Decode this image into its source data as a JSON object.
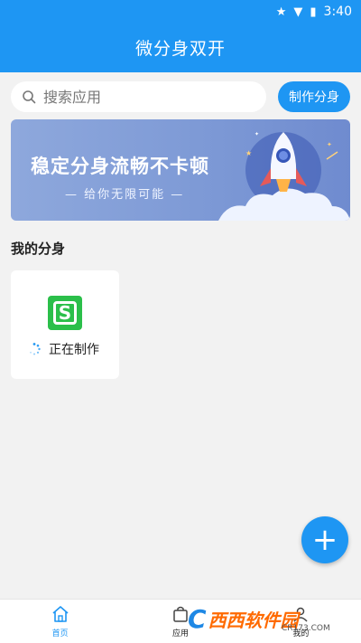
{
  "status_bar": {
    "time": "3:40",
    "icons": [
      "star-icon",
      "wifi-icon",
      "battery-icon"
    ]
  },
  "header": {
    "title": "微分身双开"
  },
  "search": {
    "placeholder": "搜索应用"
  },
  "make_button": {
    "label": "制作分身"
  },
  "banner": {
    "headline": "稳定分身流畅不卡顿",
    "subline": "— 给你无限可能 —"
  },
  "section": {
    "title": "我的分身"
  },
  "clone_card": {
    "app_icon": "green-s-app-icon",
    "status": "正在制作"
  },
  "fab": {
    "label": "+"
  },
  "bottom_nav": {
    "items": [
      {
        "label": "首页",
        "icon": "home-icon",
        "active": true
      },
      {
        "label": "应用",
        "icon": "bag-icon",
        "active": false
      },
      {
        "label": "我的",
        "icon": "user-icon",
        "active": false
      }
    ]
  },
  "watermark": {
    "brand": "西西软件园",
    "site": "CR173.COM"
  },
  "colors": {
    "primary": "#1e96f3",
    "app_green": "#2bbf4a",
    "background": "#f2f2f2"
  }
}
